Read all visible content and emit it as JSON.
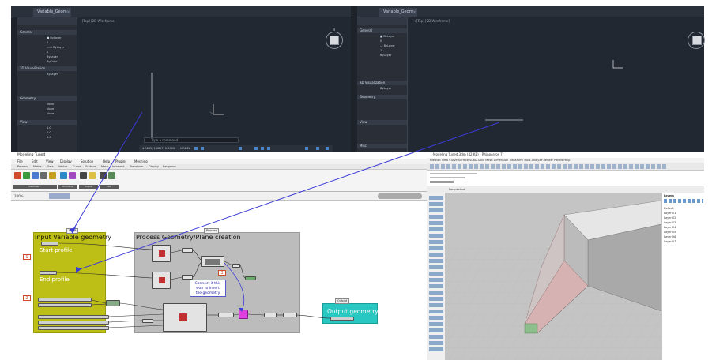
{
  "cad": {
    "left_tab": "Variable_Geom",
    "right_tab": "Variable_Geom",
    "left_view_label": "[Top] [2D Wireframe]",
    "right_view_label": "[+[Top] [2D Wireframe]",
    "command_prompt": "Type a command",
    "status_model": "MODEL",
    "status_coords": "4.0665, 1.0297, 0.0000",
    "viewcube_face": "TOP",
    "viewcube_north": "N",
    "property_sections": [
      "General",
      "3D Visualization",
      "Geometry",
      "View",
      "Misc"
    ]
  },
  "grasshopper": {
    "window_title": "Modeling Tuned",
    "menu": [
      "File",
      "Edit",
      "View",
      "Display",
      "Solution",
      "Help",
      "Plugins",
      "Meshing"
    ],
    "tabs": [
      "Params",
      "Maths",
      "Sets",
      "Vector",
      "Curve",
      "Surface",
      "Mesh",
      "Intersect",
      "Transform",
      "Display",
      "Kangaroo"
    ],
    "ribbon_groups": [
      "Geometry",
      "Primitive",
      "Input",
      "Util"
    ],
    "zoom": "100%",
    "groups": {
      "input": "Input Variable geometry",
      "process": "Process Geometry/Plane creation",
      "output": "Output geometry"
    },
    "labels": {
      "start_profile": "Start profile",
      "end_profile": "End profile"
    },
    "tags": [
      "1",
      "2",
      "3"
    ],
    "note": {
      "lines": [
        "Connect it this",
        "way to invert",
        "the geometry"
      ]
    }
  },
  "rhino": {
    "window_title": "Modeling Tuned.3dm (42 KB) - Rhinoceros 7",
    "menu": "File  Edit  View  Curve  Surface  SubD  Solid  Mesh  Dimension  Transform  Tools  Analyze  Render  Panels  Help",
    "viewport_label": "Perspective",
    "layers_header": "Layers",
    "layers": [
      "Default",
      "Layer 01",
      "Layer 02",
      "Layer 03",
      "Layer 04",
      "Layer 05",
      "Layer 06",
      "Layer 07"
    ],
    "colors": {
      "viewport": "#c4c4c4",
      "shape_top": "#e6e6e6",
      "shape_side": "#a9a9a9",
      "pink_face": "#d6b2b2"
    }
  },
  "colors": {
    "connector": "#3b3bd6",
    "yellow_group": "#bdbf16",
    "teal_group": "#28c7c1",
    "cad_bg": "#1e232b"
  }
}
